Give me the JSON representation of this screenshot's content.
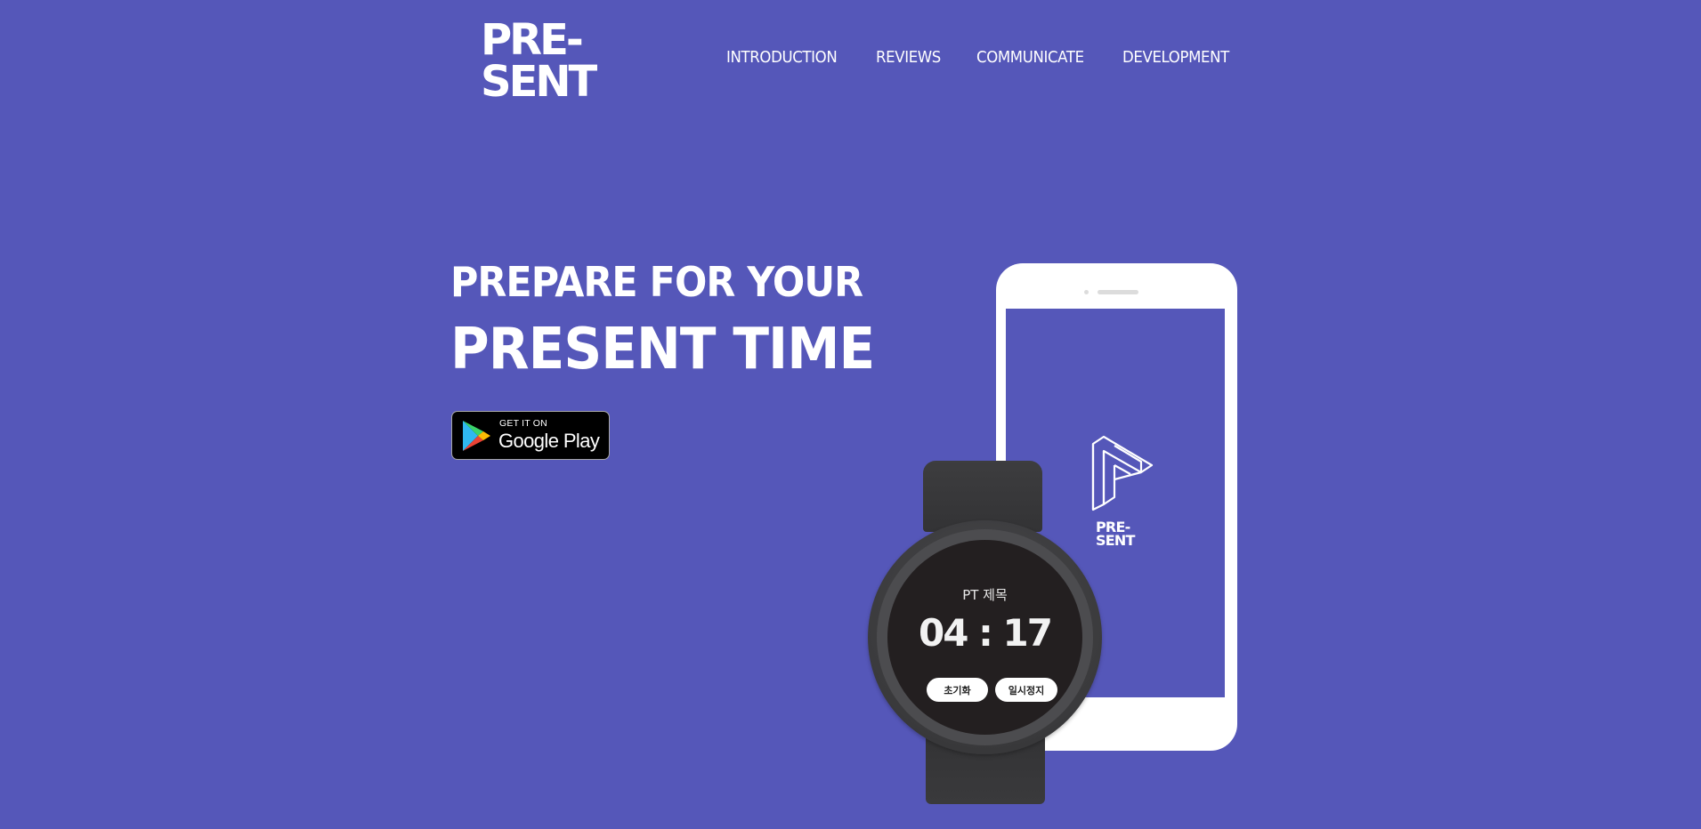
{
  "header": {
    "logo_line1": "PRE-",
    "logo_line2": "SENT",
    "nav": [
      {
        "label": "INTRODUCTION"
      },
      {
        "label": "REVIEWS"
      },
      {
        "label": "COMMUNICATE"
      },
      {
        "label": "DEVELOPMENT"
      }
    ]
  },
  "hero": {
    "line1": "PREPARE FOR YOUR",
    "line2": "PRESENT TIME",
    "store_badge": {
      "small_text": "GET IT ON",
      "big_text": "Google Play",
      "icon": "google-play-icon"
    }
  },
  "phone": {
    "app_logo_line1": "PRE-",
    "app_logo_line2": "SENT",
    "icon": "present-logo-icon"
  },
  "watch": {
    "title": "PT 제목",
    "time": "04 : 17",
    "reset_label": "초기화",
    "pause_label": "일시정지"
  },
  "colors": {
    "background": "#5557b9",
    "text": "#ffffff",
    "watch_face": "#231f20",
    "watch_case": "#3a3a3c"
  }
}
